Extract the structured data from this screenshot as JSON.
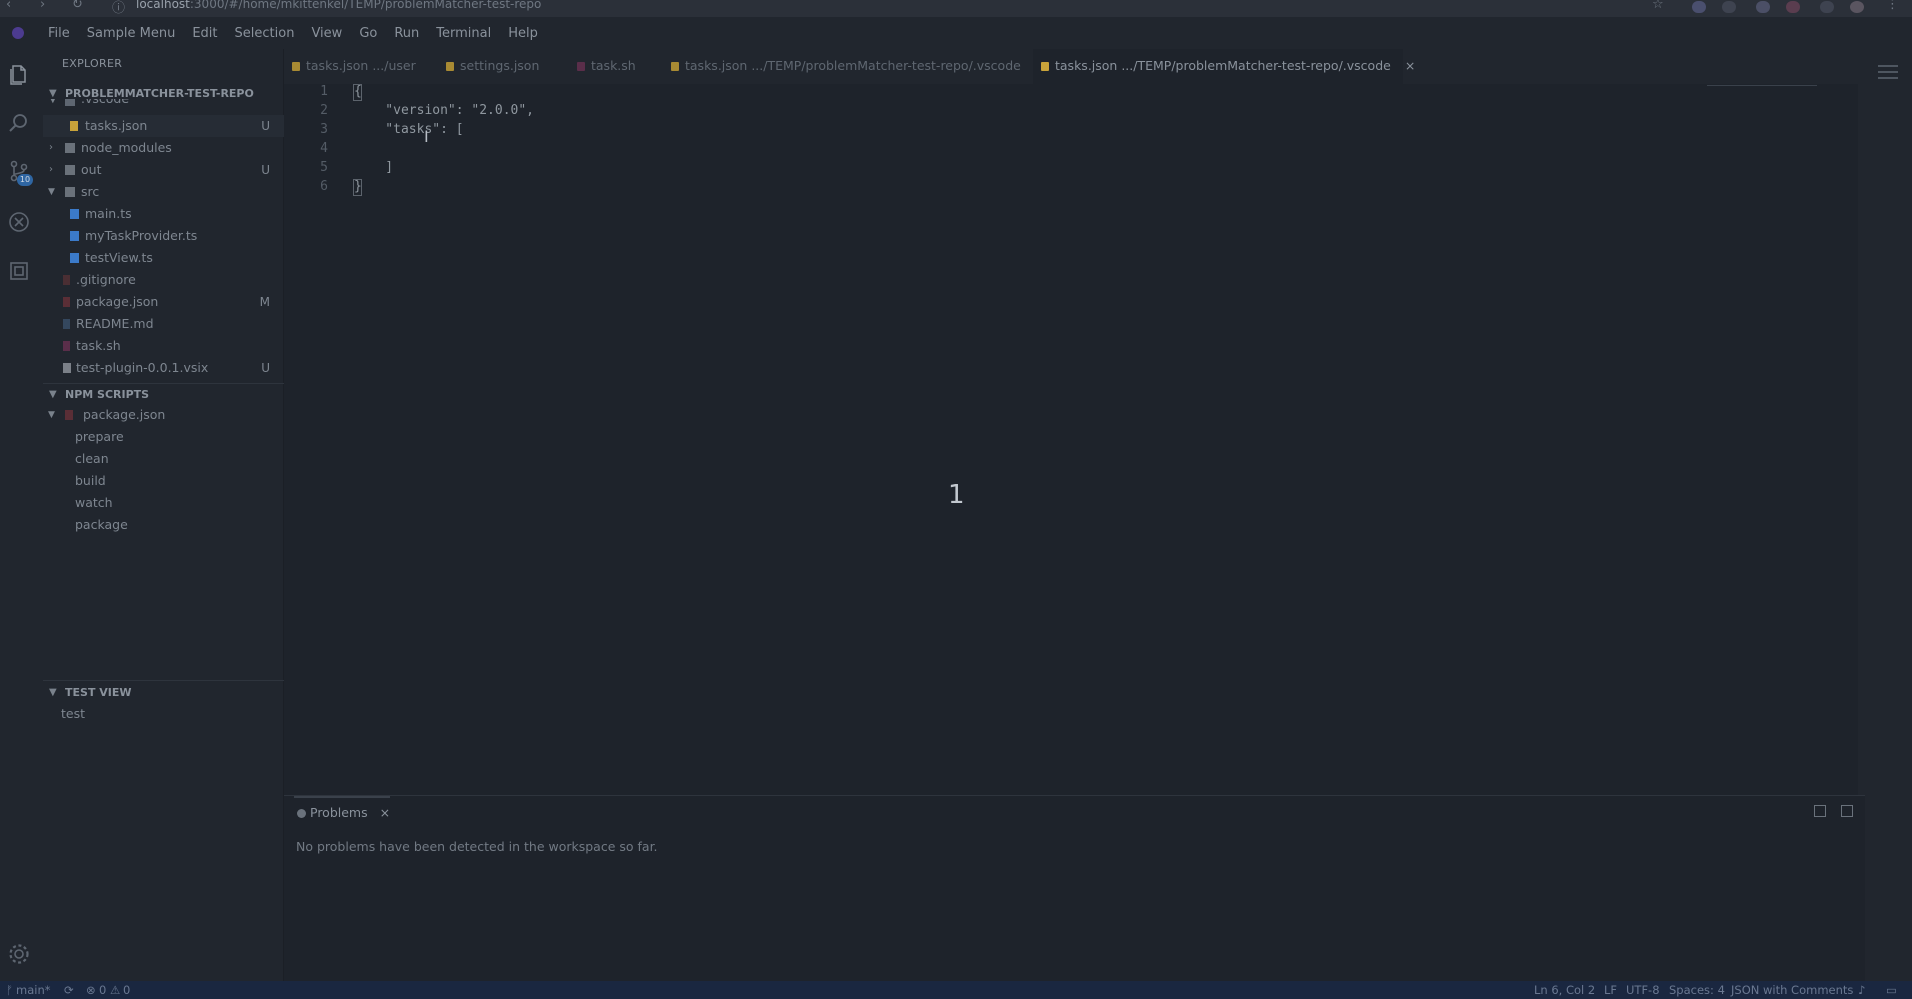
{
  "browser": {
    "url_host": "localhost",
    "url_rest": ":3000/#/home/mkittenkel/TEMP/problemMatcher-test-repo"
  },
  "menubar": {
    "items": [
      "File",
      "Sample Menu",
      "Edit",
      "Selection",
      "View",
      "Go",
      "Run",
      "Terminal",
      "Help"
    ]
  },
  "activity": {
    "scm_badge": "10"
  },
  "sidebar": {
    "title": "EXPLORER",
    "workspace": "PROBLEMMATCHER-TEST-REPO",
    "files": [
      {
        "label": ".vscode",
        "status": ""
      },
      {
        "label": "tasks.json",
        "status": "U"
      },
      {
        "label": "node_modules",
        "status": ""
      },
      {
        "label": "out",
        "status": "U"
      },
      {
        "label": "src",
        "status": ""
      },
      {
        "label": "main.ts",
        "status": ""
      },
      {
        "label": "myTaskProvider.ts",
        "status": ""
      },
      {
        "label": "testView.ts",
        "status": ""
      },
      {
        "label": ".gitignore",
        "status": ""
      },
      {
        "label": "package.json",
        "status": "M"
      },
      {
        "label": "README.md",
        "status": ""
      },
      {
        "label": "task.sh",
        "status": ""
      },
      {
        "label": "test-plugin-0.0.1.vsix",
        "status": "U"
      }
    ],
    "npm_title": "NPM SCRIPTS",
    "npm_root": "package.json",
    "npm_items": [
      "prepare",
      "clean",
      "build",
      "watch",
      "package"
    ],
    "testview_title": "TEST VIEW",
    "testview_items": [
      "test"
    ]
  },
  "tabs": [
    {
      "label": "tasks.json .../user"
    },
    {
      "label": "settings.json"
    },
    {
      "label": "task.sh"
    },
    {
      "label": "tasks.json .../TEMP/problemMatcher-test-repo/.vscode"
    },
    {
      "label": "tasks.json .../TEMP/problemMatcher-test-repo/.vscode",
      "close": "×"
    }
  ],
  "editor": {
    "lines": [
      "1",
      "2",
      "3",
      "4",
      "5",
      "6"
    ],
    "code": [
      "{",
      "    \"version\": \"2.0.0\",",
      "    \"tasks\": [",
      "",
      "    ]",
      "}"
    ],
    "overlay_number": "1"
  },
  "panel": {
    "tab": "Problems",
    "close": "×",
    "message": "No problems have been detected in the workspace so far."
  },
  "status": {
    "branch": "main*",
    "errors": "0",
    "warnings": "0",
    "position": "Ln 6, Col 2",
    "eol": "LF",
    "encoding": "UTF-8",
    "indent": "Spaces: 4",
    "language": "JSON with Comments"
  },
  "colors": {
    "background": "#1e232b",
    "sidebar": "#21262e",
    "status_bar": "#1a2740",
    "json_icon": "#c9a33a",
    "ts_icon": "#3b7ac9",
    "vsix_icon": "#7b8088"
  }
}
